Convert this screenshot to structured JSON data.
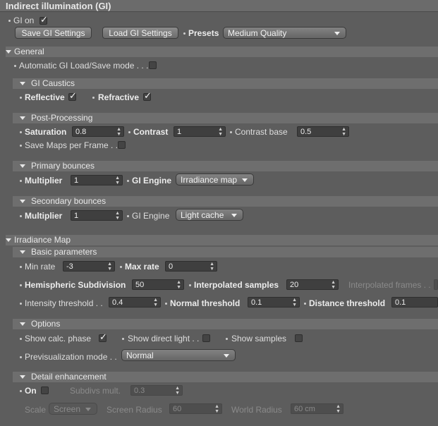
{
  "title": "Indirect illumination (GI)",
  "gi_on": {
    "label": "GI on",
    "checked": true
  },
  "buttons": {
    "save": "Save GI Settings",
    "load": "Load GI Settings"
  },
  "presets": {
    "label": "Presets",
    "value": "Medium Quality"
  },
  "general": {
    "header": "General",
    "auto_label": "Automatic GI Load/Save mode . . .",
    "auto_checked": false,
    "caustics": {
      "header": "GI Caustics",
      "reflective": "Reflective",
      "reflective_checked": true,
      "refractive": "Refractive",
      "refractive_checked": true
    },
    "post": {
      "header": "Post-Processing",
      "saturation_label": "Saturation",
      "saturation": "0.8",
      "contrast_label": "Contrast",
      "contrast": "1",
      "contrast_base_label": "Contrast base",
      "contrast_base": "0.5",
      "save_maps_label": "Save Maps per Frame . .",
      "save_maps_checked": false
    },
    "primary": {
      "header": "Primary bounces",
      "multiplier_label": "Multiplier",
      "multiplier": "1",
      "engine_label": "GI Engine",
      "engine": "Irradiance map"
    },
    "secondary": {
      "header": "Secondary bounces",
      "multiplier_label": "Multiplier",
      "multiplier": "1",
      "engine_label": "GI Engine",
      "engine": "Light cache"
    }
  },
  "irradiance": {
    "header": "Irradiance Map",
    "basic": {
      "header": "Basic parameters",
      "min_rate_label": "Min rate",
      "min_rate": "-3",
      "max_rate_label": "Max rate",
      "max_rate": "0",
      "hemi_label": "Hemispheric Subdivision",
      "hemi": "50",
      "interp_label": "Interpolated samples",
      "interp": "20",
      "interp_frames_label": "Interpolated frames . .",
      "intensity_label": "Intensity threshold . .",
      "intensity": "0.4",
      "normal_label": "Normal threshold",
      "normal": "0.1",
      "distance_label": "Distance threshold",
      "distance": "0.1"
    },
    "options": {
      "header": "Options",
      "calc_label": "Show calc. phase",
      "calc_checked": true,
      "direct_label": "Show direct light . .",
      "direct_checked": false,
      "samples_label": "Show samples",
      "samples_checked": false,
      "previs_label": "Previsualization mode . .",
      "previs": "Normal"
    },
    "detail": {
      "header": "Detail enhancement",
      "on_label": "On",
      "on_checked": false,
      "subdivs_label": "Subdivs mult.",
      "subdivs": "0.3",
      "scale_label": "Scale",
      "scale": "Screen",
      "screen_radius_label": "Screen Radius",
      "screen_radius": "60",
      "world_radius_label": "World Radius",
      "world_radius": "60 cm"
    }
  },
  "check_glyph": "✓"
}
